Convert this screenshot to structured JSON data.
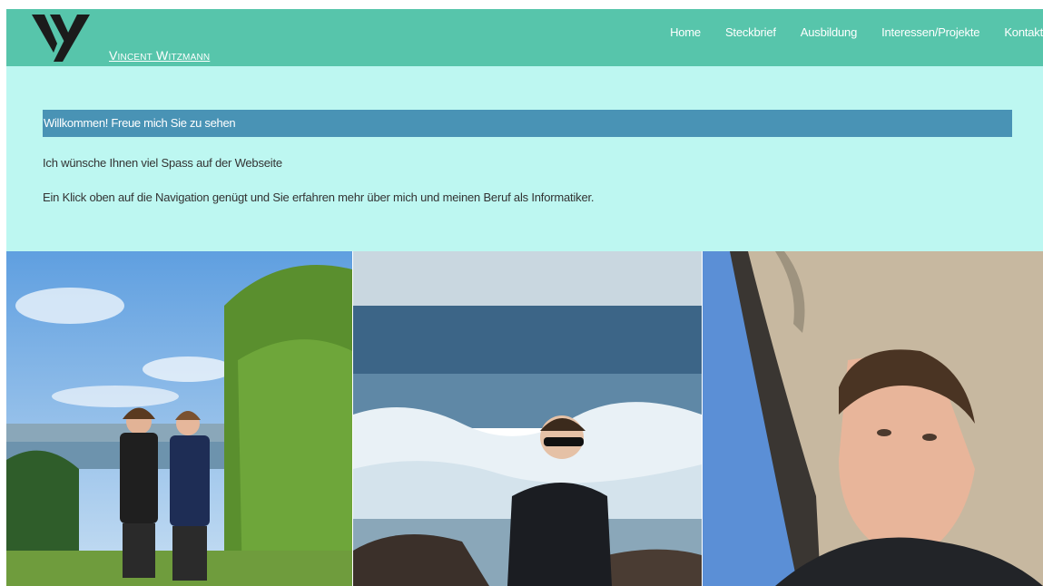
{
  "header": {
    "site_name": "Vincent Witzmann",
    "logo_icon": "v-logo-icon",
    "nav": [
      {
        "label": "Home"
      },
      {
        "label": "Steckbrief"
      },
      {
        "label": "Ausbildung"
      },
      {
        "label": "Interessen/Projekte"
      },
      {
        "label": "Kontakt"
      }
    ]
  },
  "main": {
    "welcome_title": "Willkommen! Freue mich Sie zu sehen",
    "paragraphs": [
      "Ich wünsche Ihnen viel Spass auf der Webseite",
      "Ein Klick oben auf die Navigation genügt und Sie erfahren mehr über mich und meinen Beruf als Informatiker."
    ]
  },
  "gallery": {
    "photos": [
      {
        "subject": "two-boys-by-sea-photo"
      },
      {
        "subject": "boy-at-ocean-waves-photo"
      },
      {
        "subject": "selfie-in-car-photo"
      }
    ]
  },
  "colors": {
    "header_bg": "#57c5ab",
    "content_bg": "#bdf7f1",
    "welcome_bar": "#4993b5",
    "text": "#333333"
  }
}
